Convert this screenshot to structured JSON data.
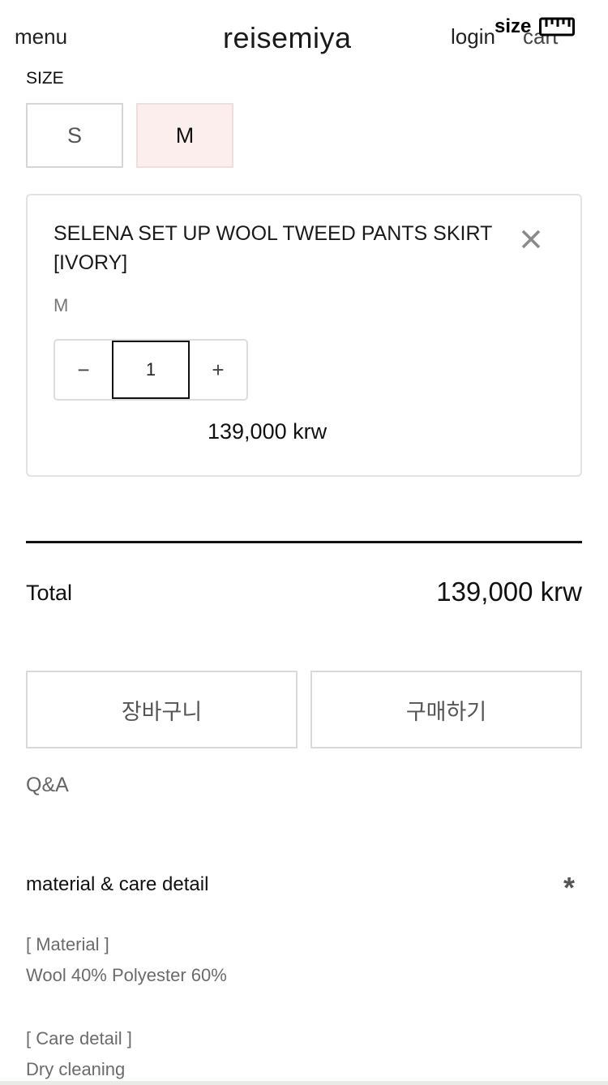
{
  "header": {
    "menu_label": "menu",
    "logo_text": "reisemiya",
    "login_label": "login",
    "cart_label": "cart",
    "size_label": "size",
    "size_icon": "ruler-icon"
  },
  "size_selector": {
    "label": "SIZE",
    "options": [
      {
        "label": "S",
        "selected": false
      },
      {
        "label": "M",
        "selected": true
      }
    ],
    "selected_color": "#fdeeee"
  },
  "selected_item": {
    "name_line1": "SELENA SET UP WOOL TWEED PANTS SKIRT",
    "name_line2": "[IVORY]",
    "option": "M",
    "remove_icon": "close-icon",
    "quantity": "1",
    "decrement_label": "−",
    "increment_label": "+",
    "price": "139,000 krw"
  },
  "total": {
    "label": "Total",
    "value": "139,000 krw"
  },
  "actions": {
    "cart_button": "장바구니",
    "buy_button": "구매하기"
  },
  "qa": {
    "label": "Q&A"
  },
  "detail": {
    "title": "material & care detail",
    "toggle_icon": "asterisk-icon",
    "toggle_glyph": "*",
    "material_heading": "[ Material ]",
    "material_text": "Wool 40% Polyester 60%",
    "care_heading": "[ Care detail ]",
    "care_text": "Dry cleaning"
  }
}
